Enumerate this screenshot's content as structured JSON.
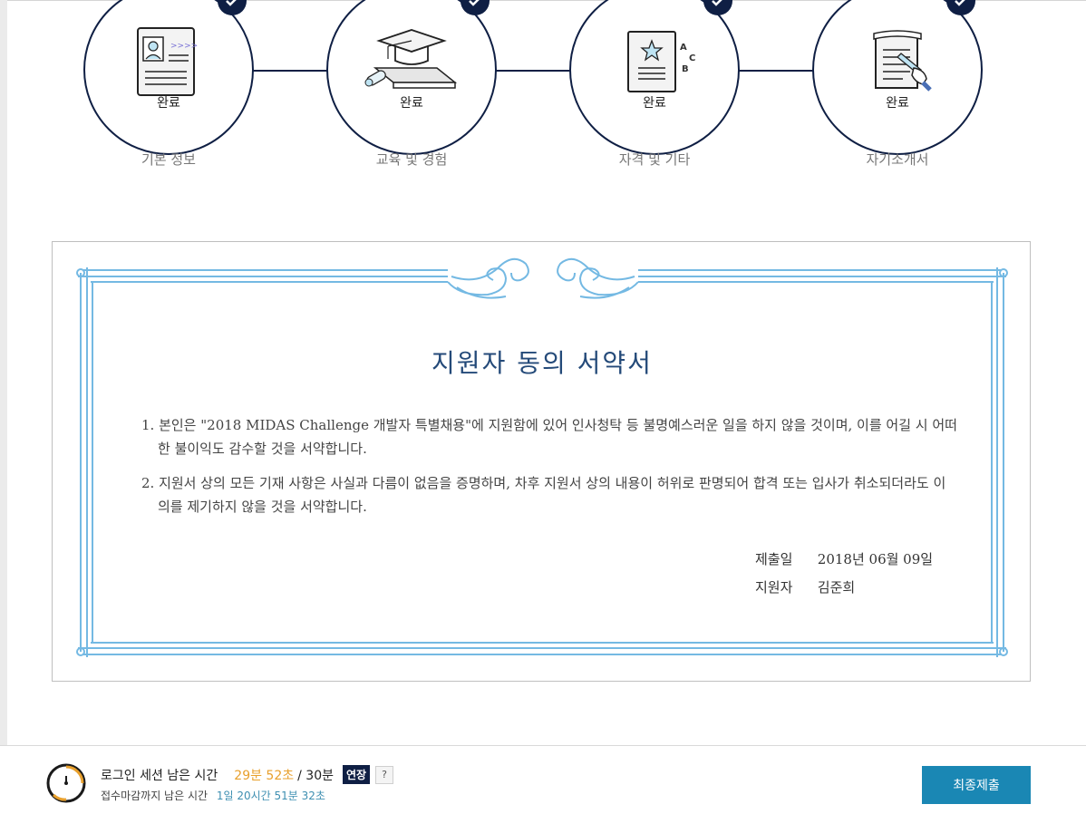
{
  "steps": [
    {
      "status": "완료",
      "label": "기본 정보",
      "icon": "resume-icon"
    },
    {
      "status": "완료",
      "label": "교육 및 경험",
      "icon": "graduation-cap-icon"
    },
    {
      "status": "완료",
      "label": "자격 및 기타",
      "icon": "certificate-abc-icon"
    },
    {
      "status": "완료",
      "label": "자기소개서",
      "icon": "writing-hand-icon"
    }
  ],
  "certificate": {
    "title": "지원자 동의 서약서",
    "items": [
      "1. 본인은 \"2018 MIDAS Challenge 개발자 특별채용\"에 지원함에 있어 인사청탁 등 불명예스러운 일을 하지 않을 것이며, 이를 어길 시 어떠한 불이익도 감수할 것을 서약합니다.",
      "2. 지원서 상의 모든 기재 사항은 사실과 다름이 없음을 증명하며, 차후 지원서 상의 내용이 허위로 판명되어 합격 또는 입사가 취소되더라도 이의를 제기하지 않을 것을 서약합니다."
    ],
    "submit_date_label": "제출일",
    "submit_date": "2018년 06월 09일",
    "applicant_label": "지원자",
    "applicant": "김준희",
    "frame_color": "#74b9e3"
  },
  "footer": {
    "session_label": "로그인 세션 남은 시간",
    "session_remaining": "29분 52초",
    "session_total": "/ 30분",
    "extend_label": "연장",
    "help_label": "?",
    "deadline_label": "접수마감까지 남은 시간",
    "deadline_remaining": "1일 20시간 51분 32초",
    "submit_label": "최종제출",
    "accent_color": "#e8a02d",
    "submit_color": "#1a87b4"
  }
}
